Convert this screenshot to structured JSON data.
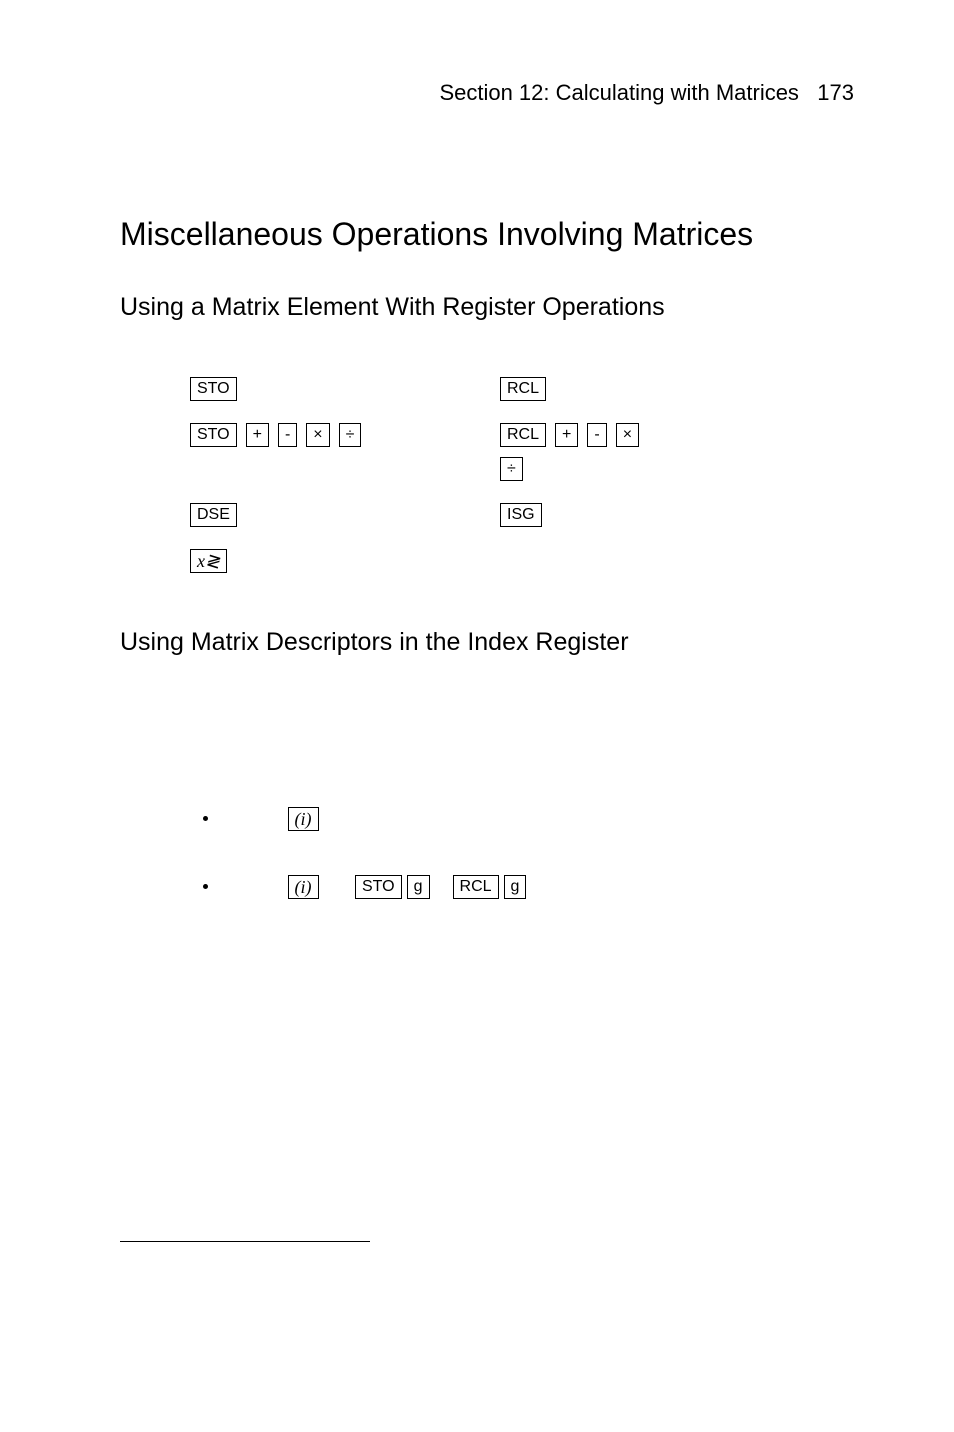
{
  "header": {
    "section_label": "Section 12: Calculating with Matrices",
    "page_num": "173"
  },
  "title": "Miscellaneous Operations Involving Matrices",
  "subheading1": "Using a Matrix Element With Register Operations",
  "subheading2": "Using Matrix Descriptors in the Index Register",
  "keys": {
    "sto": "STO",
    "rcl": "RCL",
    "plus": "+",
    "minus": "-",
    "times": "×",
    "divide": "÷",
    "dse": "DSE",
    "isg": "ISG",
    "xswap": "x≷",
    "i": "(i)",
    "g": "g"
  },
  "chart_data": null
}
